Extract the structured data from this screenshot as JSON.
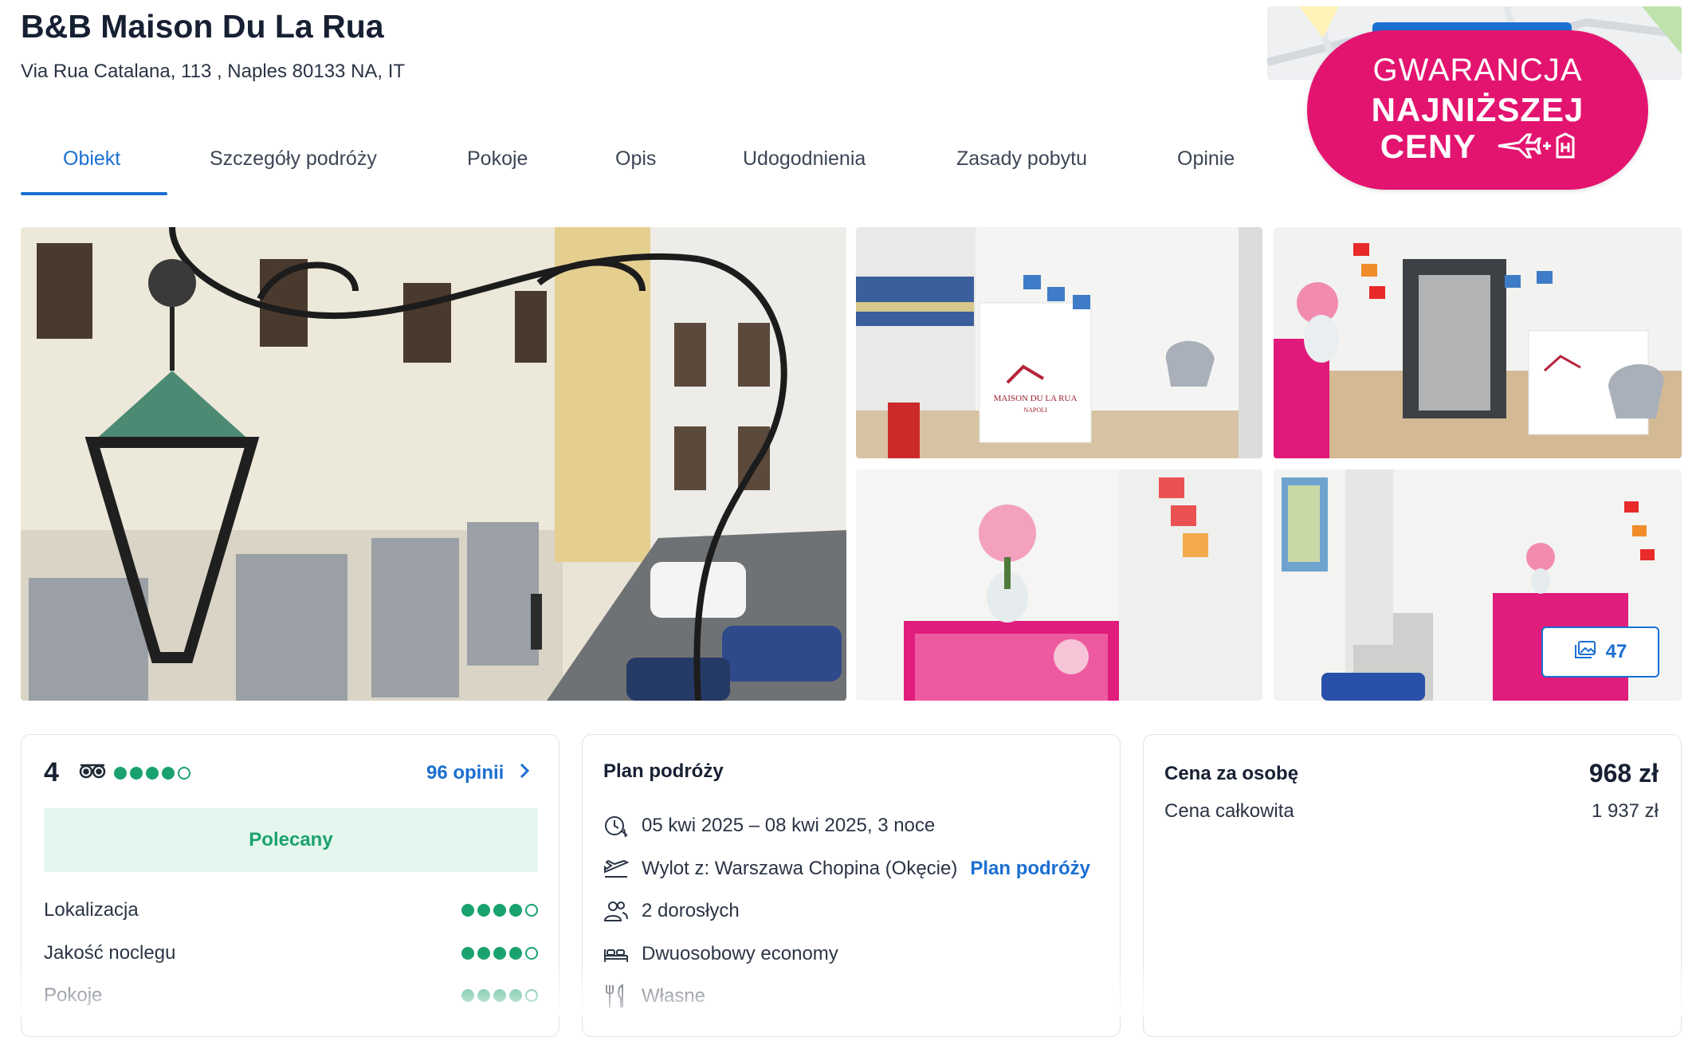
{
  "property": {
    "title": "B&B Maison Du La Rua",
    "address": "Via Rua Catalana, 113 , Naples 80133 NA, IT"
  },
  "tabs": [
    {
      "label": "Obiekt",
      "active": true
    },
    {
      "label": "Szczegóły podróży"
    },
    {
      "label": "Pokoje"
    },
    {
      "label": "Opis"
    },
    {
      "label": "Udogodnienia"
    },
    {
      "label": "Zasady pobytu"
    },
    {
      "label": "Opinie"
    }
  ],
  "badge": {
    "line1": "GWARANCJA",
    "line2": "NAJNIŻSZEJ",
    "line3": "CENY",
    "icon": "plane-plus-hotel-icon",
    "color": "#e3146f"
  },
  "gallery": {
    "photo_count": "47",
    "logo_text": "MAISON DU LA RUA",
    "logo_sub": "NAPOLI"
  },
  "rating": {
    "score": "4",
    "provider_icon": "tripadvisor-owl-icon",
    "bubbles_filled": 4,
    "bubbles_total": 5,
    "reviews_link": "96 opinii",
    "recommended": "Polecany",
    "categories": [
      {
        "label": "Lokalizacja",
        "filled": 4
      },
      {
        "label": "Jakość noclegu",
        "filled": 4
      },
      {
        "label": "Pokoje",
        "filled": 4
      }
    ]
  },
  "plan": {
    "title": "Plan podróży",
    "dates": "05 kwi 2025 – 08 kwi 2025, 3 noce",
    "departure": "Wylot z: Warszawa Chopina (Okęcie)",
    "departure_link": "Plan podróży",
    "guests": "2 dorosłych",
    "room": "Dwuosobowy economy",
    "board": "Własne"
  },
  "price": {
    "per_person_label": "Cena za osobę",
    "per_person_value": "968 zł",
    "total_label": "Cena całkowita",
    "total_value": "1 937 zł"
  },
  "colors": {
    "accent": "#1b6fd1",
    "green": "#1aa26e",
    "badge": "#e3146f"
  }
}
